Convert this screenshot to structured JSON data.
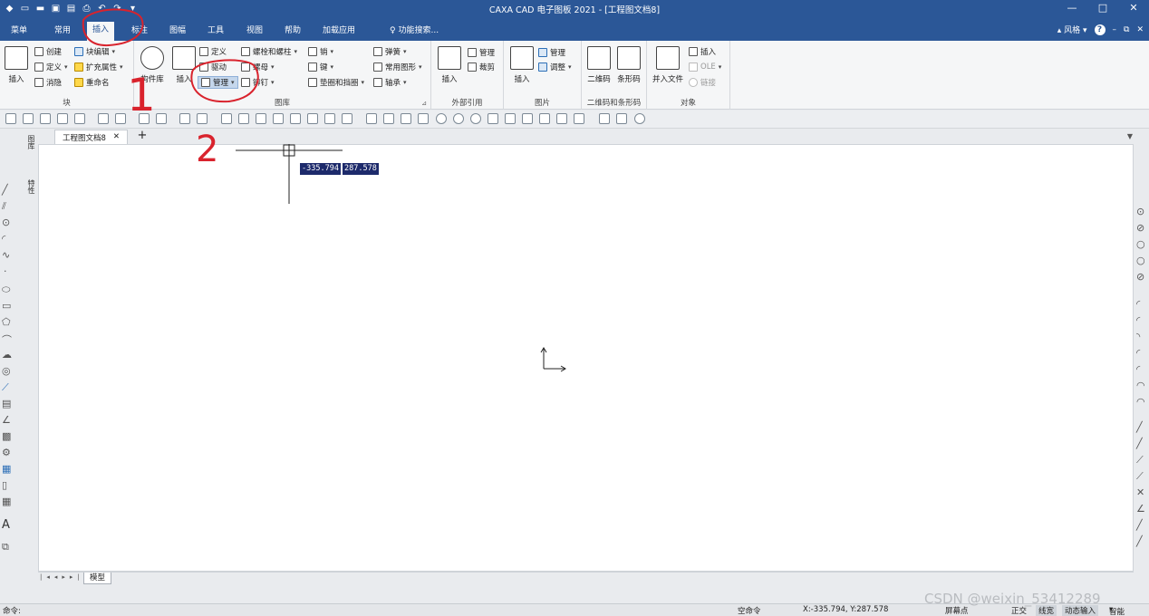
{
  "window": {
    "title": "CAXA CAD 电子图板 2021 - [工程图文档8]",
    "controls": [
      "—",
      "□",
      "✕"
    ]
  },
  "ribbon_tabs": [
    "菜单",
    "常用",
    "插入",
    "标注",
    "图幅",
    "工具",
    "视图",
    "帮助",
    "加载应用"
  ],
  "active_tab": "插入",
  "search_placeholder": "功能搜索...",
  "style_label": "风格",
  "groups": {
    "block": {
      "label": "块",
      "insert": "插入",
      "create": "创建",
      "define": "定义",
      "dissolve": "消隐",
      "block_edit": "块编辑",
      "ext_attr": "扩充属性",
      "rename": "重命名"
    },
    "library": {
      "label": "图库",
      "component_lib": "构件库",
      "insert": "插入",
      "define": "定义",
      "drive": "驱动",
      "manage": "管理",
      "bolt_screw": "螺栓和螺柱",
      "nut": "螺母",
      "rivet": "铆钉",
      "pin": "销",
      "key": "键",
      "washer": "垫圈和挡圈",
      "spring": "弹簧",
      "common_shape": "常用图形",
      "bearing": "轴承"
    },
    "external_ref": {
      "label": "外部引用",
      "insert": "插入",
      "manage": "管理",
      "clip": "裁剪"
    },
    "image": {
      "label": "图片",
      "insert": "插入",
      "manage": "管理",
      "adjust": "调整"
    },
    "barcode": {
      "label": "二维码和条形码",
      "qr": "二维码",
      "bar": "条形码"
    },
    "object": {
      "label": "对象",
      "insert_file": "并入文件",
      "insert": "插入",
      "ole": "OLE",
      "link": "链接"
    }
  },
  "doc_tab": "工程图文档8",
  "side_tabs": [
    "图库",
    "特性"
  ],
  "cursor_coords": [
    "-335.794",
    "287.578"
  ],
  "model_tab": "模型",
  "status": {
    "command": "命令:",
    "empty_command": "空命令",
    "xy": "X:-335.794, Y:287.578",
    "snap": "屏幕点",
    "ortho": "正交",
    "linewidth": "线宽",
    "dynamic_input": "动态输入",
    "smart": "智能"
  },
  "watermark": "CSDN @weixin_53412289",
  "annotations": [
    "1",
    "2"
  ],
  "colors": {
    "title_blue": "#2b5797",
    "annotation_red": "#d9232d",
    "coord_bg": "#1d2a6b"
  }
}
